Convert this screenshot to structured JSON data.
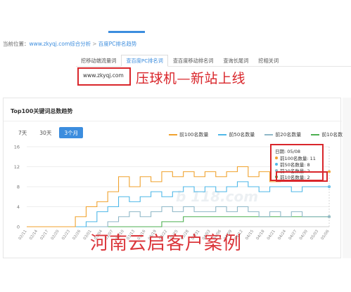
{
  "breadcrumb": {
    "prefix": "当前位置：",
    "site": "www.zkyqj.com综合分析",
    "sep": ">",
    "current": "百度PC排名趋势"
  },
  "tabs": [
    {
      "label": "挖移动端流量词",
      "active": false
    },
    {
      "label": "查百度PC排名词",
      "active": true
    },
    {
      "label": "查百度移动排名词",
      "active": false
    },
    {
      "label": "查询长尾词",
      "active": false
    },
    {
      "label": "挖相关词",
      "active": false
    }
  ],
  "url_box": {
    "value": "www.zkyqj.com"
  },
  "overlay_title": "压球机—新站上线",
  "card": {
    "title": "Top100关键词总数趋势",
    "range_buttons": [
      {
        "label": "7天",
        "active": false
      },
      {
        "label": "30天",
        "active": false
      },
      {
        "label": "3个月",
        "active": true
      }
    ]
  },
  "tooltip": {
    "date": "日期: 05/08",
    "rows": [
      {
        "label": "前100名数量: 11",
        "color": "#f0a22e"
      },
      {
        "label": "前50名数量: 8",
        "color": "#4fb8e8"
      },
      {
        "label": "前20名数量: 2",
        "color": "#8fb8c8"
      },
      {
        "label": "前10名数量: 2",
        "color": "#4caf50"
      }
    ]
  },
  "watermark": "河南云启客户案例",
  "faint_watermark": "b 118.com",
  "chart_data": {
    "type": "line",
    "title": "Top100关键词总数趋势",
    "ylim": [
      0,
      16
    ],
    "yticks": [
      0,
      4,
      8,
      12,
      16
    ],
    "grid": true,
    "legend_position": "top-right",
    "x": [
      "02/11",
      "02/14",
      "02/17",
      "02/20",
      "02/23",
      "02/26",
      "03/01",
      "03/04",
      "03/07",
      "03/10",
      "03/13",
      "03/16",
      "03/19",
      "03/22",
      "03/25",
      "03/28",
      "03/31",
      "04/03",
      "04/06",
      "04/09",
      "04/12",
      "04/15",
      "04/18",
      "04/21",
      "04/24",
      "04/27",
      "04/30",
      "05/03",
      "05/06"
    ],
    "series": [
      {
        "name": "前100名数量",
        "color": "#f0a22e",
        "values": [
          0,
          0,
          0,
          0,
          0,
          2,
          4,
          5,
          7,
          10,
          8,
          10,
          9,
          11,
          10,
          11,
          10,
          11,
          10,
          11,
          12,
          10,
          11,
          9,
          11,
          10,
          11,
          11,
          11
        ]
      },
      {
        "name": "前50名数量",
        "color": "#4fb8e8",
        "values": [
          0,
          0,
          0,
          0,
          0,
          0,
          1,
          3,
          4,
          6,
          5,
          6,
          7,
          6,
          7,
          8,
          7,
          8,
          7,
          8,
          9,
          8,
          7,
          8,
          8,
          7,
          8,
          8,
          8
        ]
      },
      {
        "name": "前20名数量",
        "color": "#8fb8c8",
        "values": [
          0,
          0,
          0,
          0,
          0,
          0,
          0,
          0,
          1,
          2,
          3,
          2,
          3,
          4,
          3,
          4,
          3,
          3,
          4,
          3,
          4,
          3,
          2,
          3,
          2,
          3,
          2,
          2,
          2
        ]
      },
      {
        "name": "前10名数量",
        "color": "#4caf50",
        "values": [
          0,
          0,
          0,
          0,
          0,
          0,
          0,
          0,
          0,
          0,
          0,
          0,
          0,
          1,
          1,
          2,
          2,
          2,
          2,
          2,
          2,
          2,
          2,
          2,
          2,
          2,
          2,
          2,
          2
        ]
      }
    ]
  }
}
